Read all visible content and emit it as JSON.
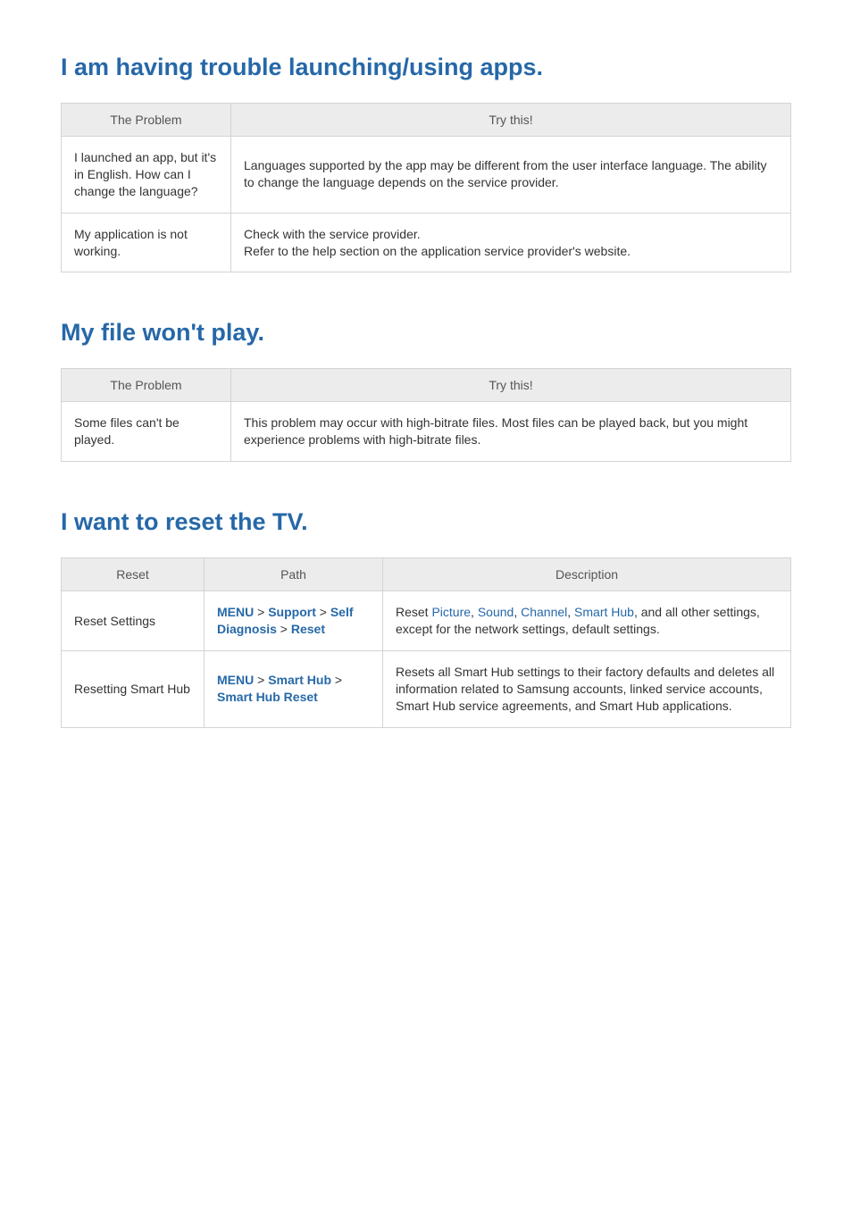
{
  "sections": [
    {
      "title": "I am having trouble launching/using apps.",
      "headers": [
        "The Problem",
        "Try this!"
      ],
      "rows": [
        {
          "problem": "I launched an app, but it's in English. How can I change the language?",
          "solution": "Languages supported by the app may be different from the user interface language. The ability to change the language depends on the service provider."
        },
        {
          "problem": "My application is not working.",
          "solution": "Check with the service provider.\nRefer to the help section on the application service provider's website."
        }
      ]
    },
    {
      "title": "My file won't play.",
      "headers": [
        "The Problem",
        "Try this!"
      ],
      "rows": [
        {
          "problem": "Some files can't be played.",
          "solution": "This problem may occur with high-bitrate files. Most files can be played back, but you might experience problems with high-bitrate files."
        }
      ]
    },
    {
      "title": "I want to reset the TV.",
      "headers": [
        "Reset",
        "Path",
        "Description"
      ],
      "rows": [
        {
          "reset": "Reset Settings",
          "path_parts": [
            "MENU",
            " > ",
            "Support",
            " > ",
            "Self Diagnosis",
            " > ",
            "Reset"
          ],
          "desc_prefix": "Reset ",
          "desc_terms": [
            "Picture",
            ", ",
            "Sound",
            ", ",
            "Channel",
            ", ",
            "Smart Hub"
          ],
          "desc_suffix": ", and all other settings, except for the network settings, default settings."
        },
        {
          "reset": "Resetting Smart Hub",
          "path_parts": [
            "MENU",
            " > ",
            "Smart Hub",
            " > ",
            "Smart Hub Reset"
          ],
          "desc_plain": "Resets all Smart Hub settings to their factory defaults and deletes all information related to Samsung accounts, linked service accounts, Smart Hub service agreements, and Smart Hub applications."
        }
      ]
    }
  ]
}
